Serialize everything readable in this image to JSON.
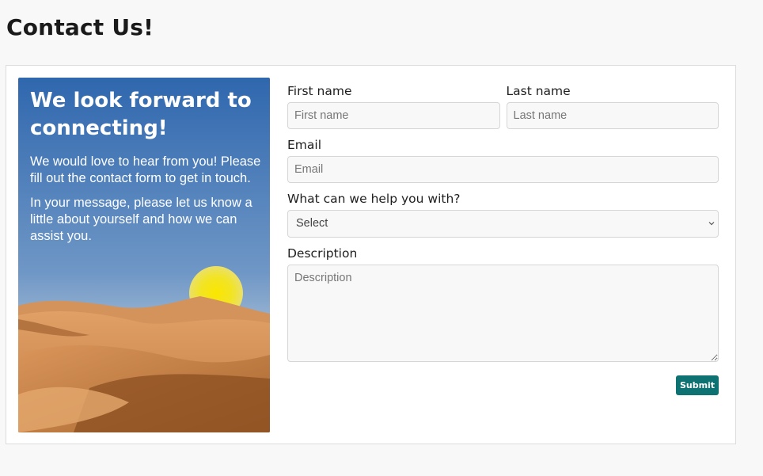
{
  "page": {
    "title": "Contact Us!"
  },
  "hero": {
    "heading": "We look forward to connecting!",
    "paragraphs": [
      "We would love to hear from you! Please fill out the contact form to get in touch.",
      "In your message, please let us know a little about yourself and how we can assist you."
    ],
    "image": "desert-dunes-with-sun",
    "colors": {
      "sky_top": "#2e68b0",
      "sky_bottom": "#9cb6d2",
      "sun": "#f4e21a",
      "sand": "#cf8a4e"
    }
  },
  "form": {
    "first_name": {
      "label": "First name",
      "placeholder": "First name"
    },
    "last_name": {
      "label": "Last name",
      "placeholder": "Last name"
    },
    "email": {
      "label": "Email",
      "placeholder": "Email"
    },
    "help": {
      "label": "What can we help you with?",
      "selected": "Select"
    },
    "description": {
      "label": "Description",
      "placeholder": "Description"
    },
    "submit_label": "Submit"
  },
  "colors": {
    "accent": "#0e7272",
    "background": "#f8f8f8"
  }
}
